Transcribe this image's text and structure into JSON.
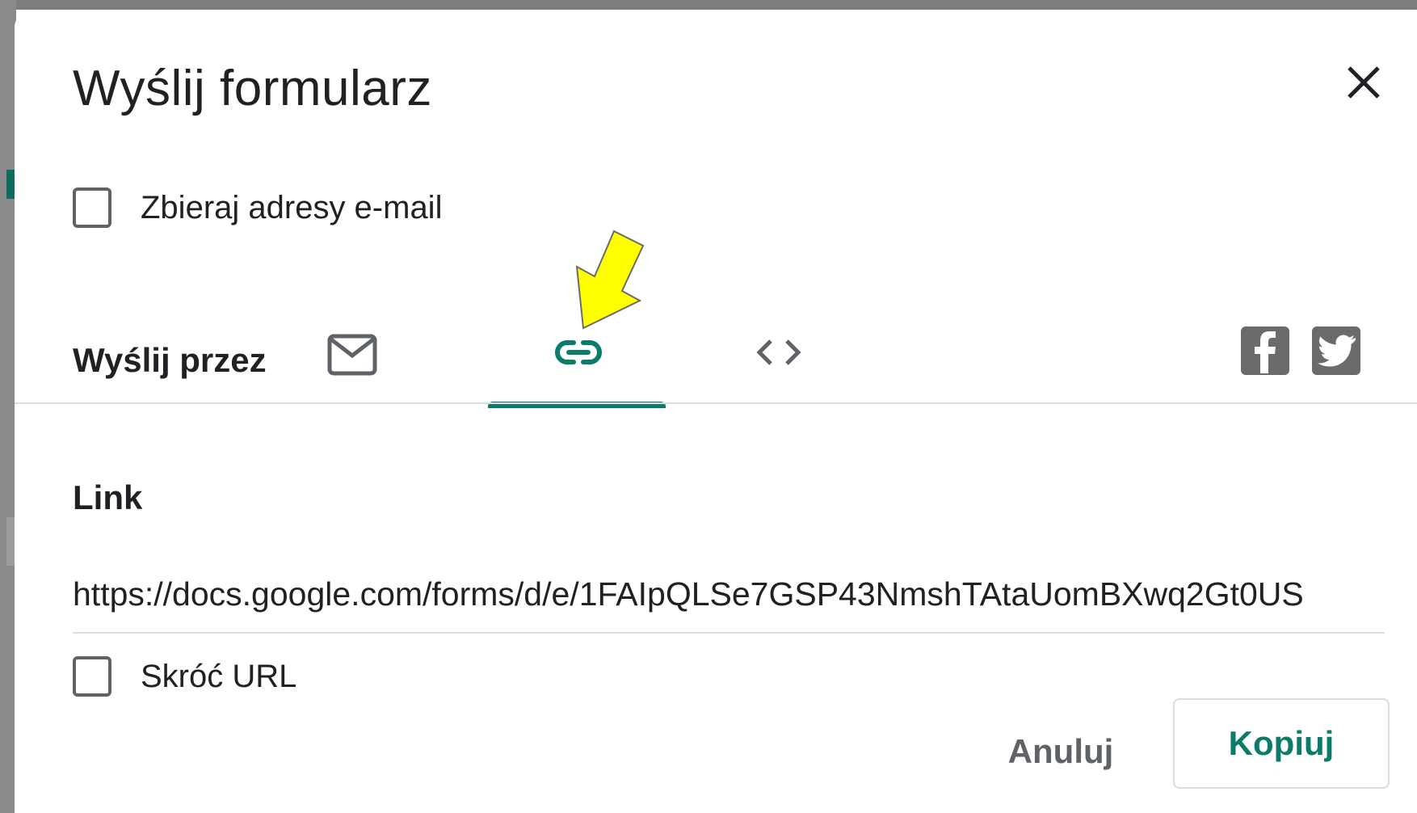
{
  "dialog": {
    "title": "Wyślij formularz",
    "collect_emails_label": "Zbieraj adresy e-mail",
    "send_via_label": "Wyślij przez",
    "tabs": [
      {
        "icon": "email-icon",
        "selected": false
      },
      {
        "icon": "link-icon",
        "selected": true
      },
      {
        "icon": "embed-code-icon",
        "selected": false
      }
    ],
    "social": [
      {
        "icon": "facebook-icon"
      },
      {
        "icon": "twitter-icon"
      }
    ],
    "link_section": {
      "heading": "Link",
      "url": "https://docs.google.com/forms/d/e/1FAIpQLSe7GSP43NmshTAtaUomBXwq2Gt0US",
      "shorten_label": "Skróć URL"
    },
    "buttons": {
      "cancel": "Anuluj",
      "copy": "Kopiuj"
    }
  },
  "annotation": {
    "icon": "yellow-arrow-icon",
    "color": "#ffff00"
  },
  "colors": {
    "accent": "#0b7b6a",
    "text": "#202124",
    "muted": "#5f6368",
    "divider": "#dadce0",
    "social": "#6b6b6b"
  }
}
